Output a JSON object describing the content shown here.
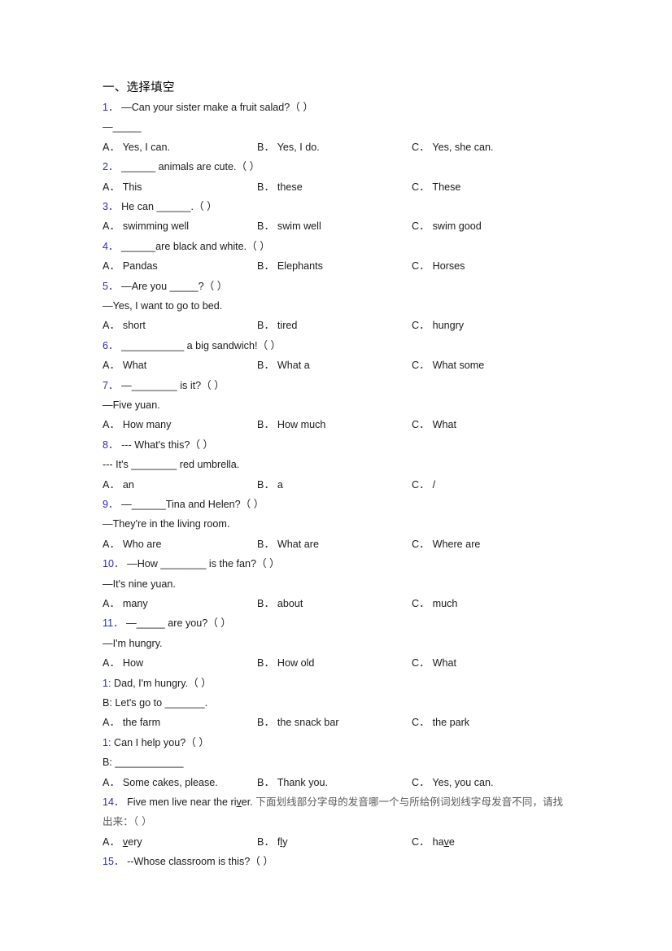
{
  "document": {
    "section_title": "一、选择填空",
    "option_labels": {
      "a": "A．",
      "b": "B．",
      "c": "C．"
    },
    "blank_short": "_____",
    "blank_medium": "_______",
    "blank_long": "___________",
    "paren": "（  ）",
    "colors": {
      "question_number": "#2a2ac4",
      "body_text": "#1b1b1b",
      "chinese_gray": "#5a5a5a",
      "page_background": "#ffffff"
    },
    "questions": [
      {
        "number": "1．",
        "stem": "—Can your sister make a fruit salad?（  ）",
        "sub": "—_____",
        "options": {
          "a": "Yes, I can.",
          "b": "Yes, I do.",
          "c": "Yes, she can."
        }
      },
      {
        "number": "2．",
        "stem": "______ animals are cute.（  ）",
        "options": {
          "a": "This",
          "b": "these",
          "c": "These"
        }
      },
      {
        "number": "3．",
        "stem": "He can ______.（  ）",
        "options": {
          "a": "swimming well",
          "b": "swim well",
          "c": "swim good"
        }
      },
      {
        "number": "4．",
        "stem": "______are black and white.（  ）",
        "options": {
          "a": "Pandas",
          "b": "Elephants",
          "c": "Horses"
        }
      },
      {
        "number": "5．",
        "stem": "—Are you _____?（  ）",
        "sub": "—Yes, I want to go to bed.",
        "options": {
          "a": "short",
          "b": "tired",
          "c": "hungry"
        }
      },
      {
        "number": "6．",
        "stem": "___________ a big sandwich!（  ）",
        "options": {
          "a": "What",
          "b": "What a",
          "c": "What some"
        }
      },
      {
        "number": "7．",
        "stem": "—________ is it?（  ）",
        "sub": "—Five yuan.",
        "options": {
          "a": "How many",
          "b": "How much",
          "c": "What"
        }
      },
      {
        "number": "8．",
        "stem": "--- What's this?（  ）",
        "sub": "--- It's ________ red umbrella.",
        "options": {
          "a": "an",
          "b": "a",
          "c": "/"
        }
      },
      {
        "number": "9．",
        "stem": "—______Tina and Helen?（  ）",
        "sub": "—They're in the living room.",
        "options": {
          "a": "Who are",
          "b": "What are",
          "c": "Where are"
        }
      },
      {
        "number": "10．",
        "stem": "—How ________ is the fan?（    ）",
        "sub": "—It's nine yuan.",
        "options": {
          "a": "many",
          "b": "about",
          "c": "much"
        }
      },
      {
        "number": "11．",
        "stem": "—_____ are you?（  ）",
        "sub": "—I'm hungry.",
        "options": {
          "a": "How",
          "b": "How old",
          "c": "What"
        }
      },
      {
        "number": "1:",
        "stem": " Dad, I'm hungry.（  ）",
        "sub": "B: Let's go to _______.",
        "options": {
          "a": "the farm",
          "b": "the snack bar",
          "c": "the park"
        }
      },
      {
        "number": "1:",
        "stem": " Can I help you?（  ）",
        "sub": "B: ____________",
        "options": {
          "a": "Some cakes, please.",
          "b": "Thank you.",
          "c": "Yes, you can."
        }
      },
      {
        "number": "14．",
        "stem_pre": "Five men live near the ri",
        "stem_underline": "v",
        "stem_post": "er.",
        "stem_cn": "下面划线部分字母的发音哪一个与所给例词划线字母发音不同，请找出来：（  ）",
        "options_marked": [
          {
            "label": "A．",
            "pre": "",
            "u": "v",
            "post": "ery"
          },
          {
            "label": "B．",
            "pre": "f",
            "u": "l",
            "post": "y"
          },
          {
            "label": "C．",
            "pre": "ha",
            "u": "v",
            "post": "e"
          }
        ]
      },
      {
        "number": "15．",
        "stem": "--Whose classroom is this?（  ）"
      }
    ]
  }
}
